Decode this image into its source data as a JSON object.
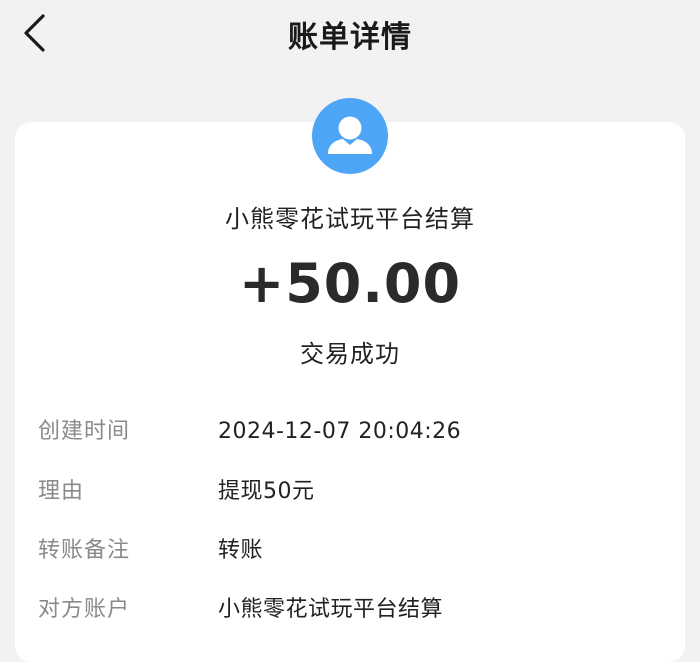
{
  "header": {
    "title": "账单详情",
    "back_icon": "chevron-left-icon"
  },
  "summary": {
    "avatar_icon": "user-avatar-icon",
    "avatar_color": "#4da6f5",
    "merchant": "小熊零花试玩平台结算",
    "amount": "+50.00",
    "status": "交易成功"
  },
  "details": [
    {
      "label": "创建时间",
      "value": "2024-12-07 20:04:26"
    },
    {
      "label": "理由",
      "value": "提现50元"
    },
    {
      "label": "转账备注",
      "value": "转账"
    },
    {
      "label": "对方账户",
      "value": "小熊零花试玩平台结算"
    }
  ]
}
